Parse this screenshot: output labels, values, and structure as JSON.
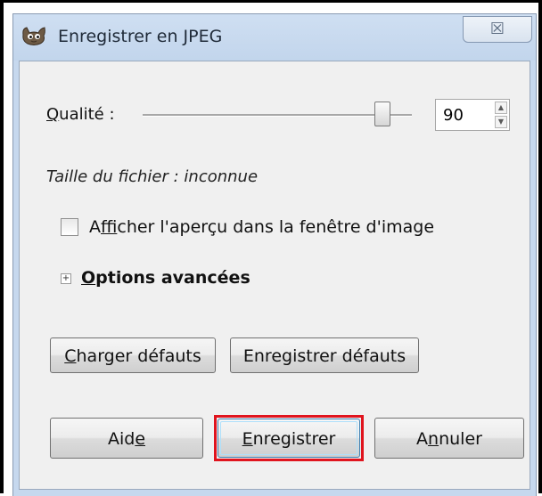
{
  "dialog": {
    "title": "Enregistrer en JPEG",
    "close_glyph": "☒",
    "icon": "gimp-wilber-icon"
  },
  "quality": {
    "label_access": "Q",
    "label_rest": "ualité :",
    "value": "90",
    "slider_fraction": 0.9
  },
  "file_size_text": "Taille du fichier : inconnue",
  "preview_checkbox": {
    "label_pre": "A",
    "label_access": "f",
    "label_post": "ficher l'aperçu dans la fenêtre d'image",
    "checked": false
  },
  "advanced": {
    "expander_glyph": "+",
    "label_access": "O",
    "label_rest": "ptions avancées"
  },
  "buttons": {
    "load_defaults_access": "C",
    "load_defaults_rest": "harger défauts",
    "save_defaults": "Enregistrer défauts",
    "help_pre": "Aid",
    "help_access": "e",
    "save_access": "E",
    "save_rest": "nregistrer",
    "cancel_pre": "A",
    "cancel_access": "n",
    "cancel_post": "nuler"
  },
  "colors": {
    "highlight": "#e0141e",
    "title_bar": "#c6d8ee"
  }
}
